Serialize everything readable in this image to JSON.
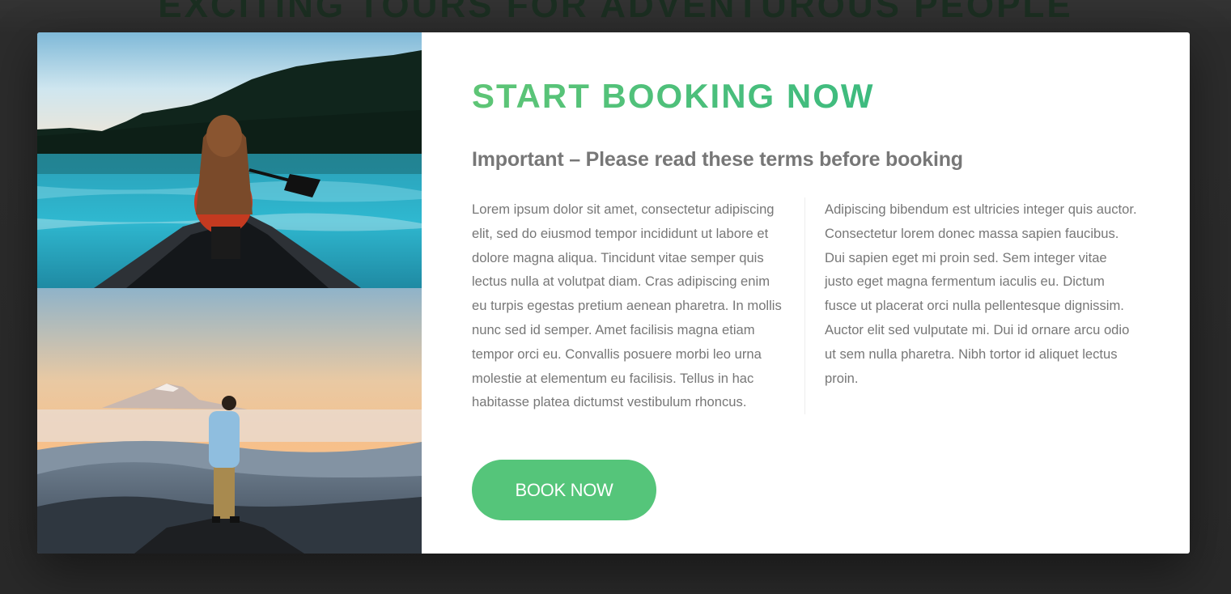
{
  "background": {
    "heading": "EXCITING TOURS FOR ADVENTUROUS PEOPLE"
  },
  "popup": {
    "images": [
      {
        "name": "woman-in-canoe-on-lake"
      },
      {
        "name": "man-on-mountain-at-sunrise"
      }
    ],
    "title": "START BOOKING NOW",
    "subtitle": "Important – Please read these terms before booking",
    "paragraph_left": "Lorem ipsum dolor sit amet, consectetur adipiscing elit, sed do eiusmod tempor incididunt ut labore et dolore magna aliqua. Tincidunt vitae semper quis lectus nulla at volutpat diam. Cras adipiscing enim eu turpis egestas pretium aenean pharetra. In mollis nunc sed id semper. Amet facilisis magna etiam tempor orci eu. Convallis posuere morbi leo urna molestie at elementum eu facilisis. Tellus in hac habitasse platea dictumst vestibulum rhoncus.",
    "paragraph_right": "Adipiscing bibendum est ultricies integer quis auctor. Consectetur lorem donec massa sapien faucibus. Dui sapien eget mi proin sed. Sem integer vitae justo eget magna fermentum iaculis eu. Dictum fusce ut placerat orci nulla pellentesque dignissim. Auctor elit sed vulputate mi. Dui id ornare arcu odio ut sem nulla pharetra. Nibh tortor id aliquet lectus proin.",
    "book_button": "BOOK NOW"
  },
  "colors": {
    "primary": "#55c57a",
    "primary_dark": "#28b485",
    "text": "#777777",
    "backdrop": "#2e2e2e"
  }
}
